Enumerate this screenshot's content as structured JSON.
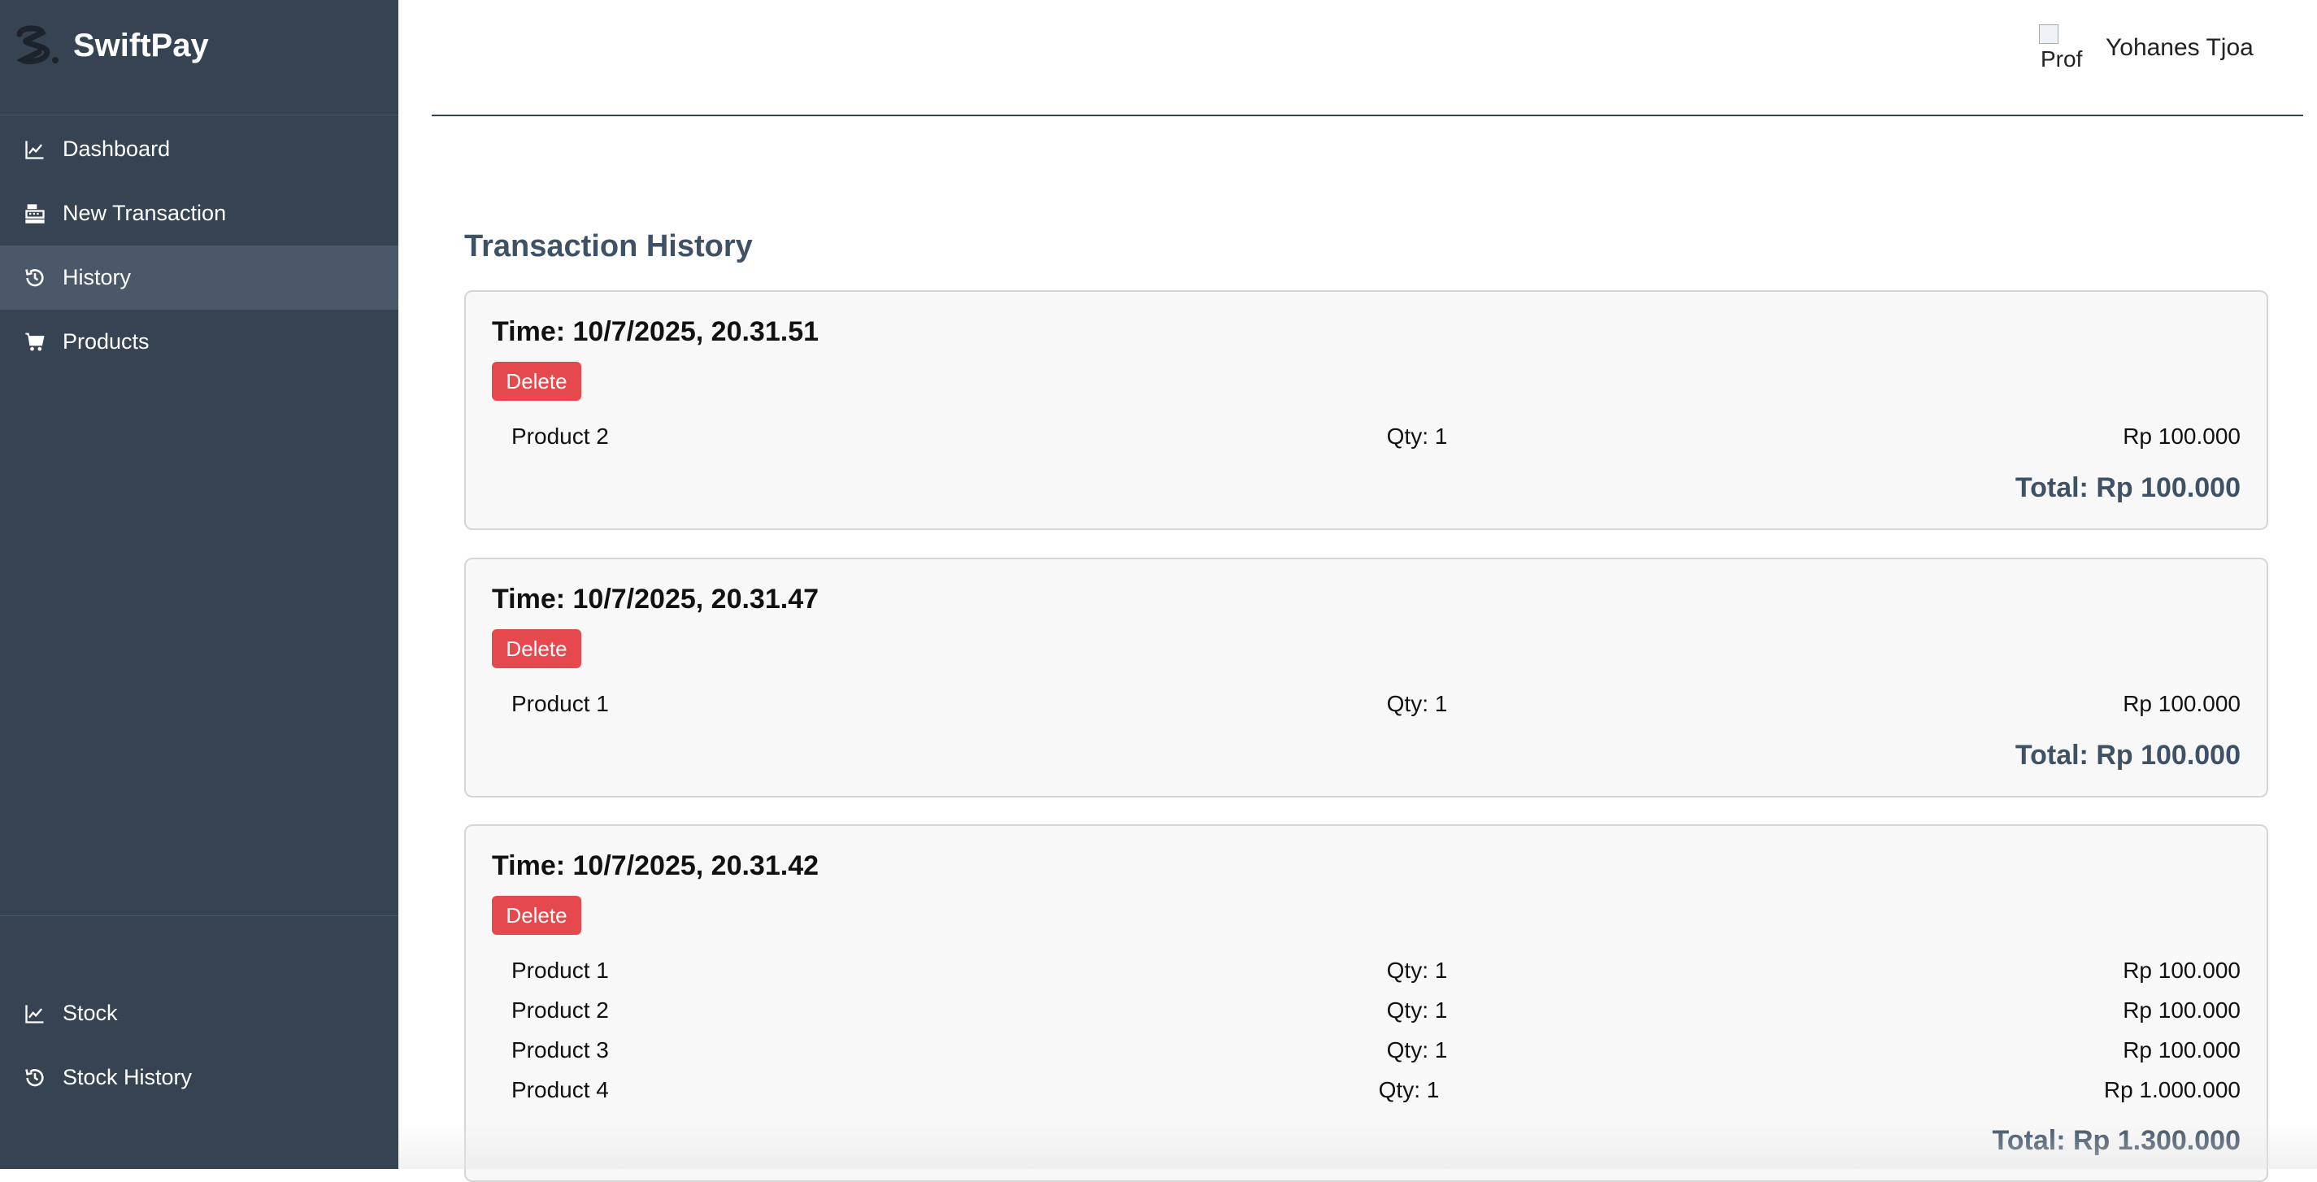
{
  "app": {
    "name": "SwiftPay"
  },
  "sidebar": {
    "items": [
      {
        "label": "Dashboard",
        "icon": "chart-line-icon"
      },
      {
        "label": "New Transaction",
        "icon": "cash-register-icon"
      },
      {
        "label": "History",
        "icon": "history-icon",
        "active": true
      },
      {
        "label": "Products",
        "icon": "cart-icon"
      }
    ],
    "bottom_items": [
      {
        "label": "Stock",
        "icon": "chart-line-icon"
      },
      {
        "label": "Stock History",
        "icon": "history-icon"
      }
    ]
  },
  "header": {
    "user_name": "Yohanes Tjoa",
    "avatar_alt": "Prof"
  },
  "main": {
    "title": "Transaction History",
    "delete_label": "Delete",
    "transactions": [
      {
        "time": "Time: 10/7/2025, 20.31.51",
        "items": [
          {
            "product": "Product 2",
            "qty": "Qty: 1",
            "price": "Rp 100.000"
          }
        ],
        "total": "Total: Rp 100.000"
      },
      {
        "time": "Time: 10/7/2025, 20.31.47",
        "items": [
          {
            "product": "Product 1",
            "qty": "Qty: 1",
            "price": "Rp 100.000"
          }
        ],
        "total": "Total: Rp 100.000"
      },
      {
        "time": "Time: 10/7/2025, 20.31.42",
        "items": [
          {
            "product": "Product 1",
            "qty": "Qty: 1",
            "price": "Rp 100.000"
          },
          {
            "product": "Product 2",
            "qty": "Qty: 1",
            "price": "Rp 100.000"
          },
          {
            "product": "Product 3",
            "qty": "Qty: 1",
            "price": "Rp 100.000"
          },
          {
            "product": "Product 4",
            "qty": "Qty: 1",
            "price": "Rp 1.000.000"
          }
        ],
        "total": "Total: Rp 1.300.000"
      }
    ]
  },
  "colors": {
    "sidebar_bg": "#354353",
    "sidebar_active": "#4a5869",
    "delete_button": "#e5484d",
    "title_color": "#3e5165"
  }
}
